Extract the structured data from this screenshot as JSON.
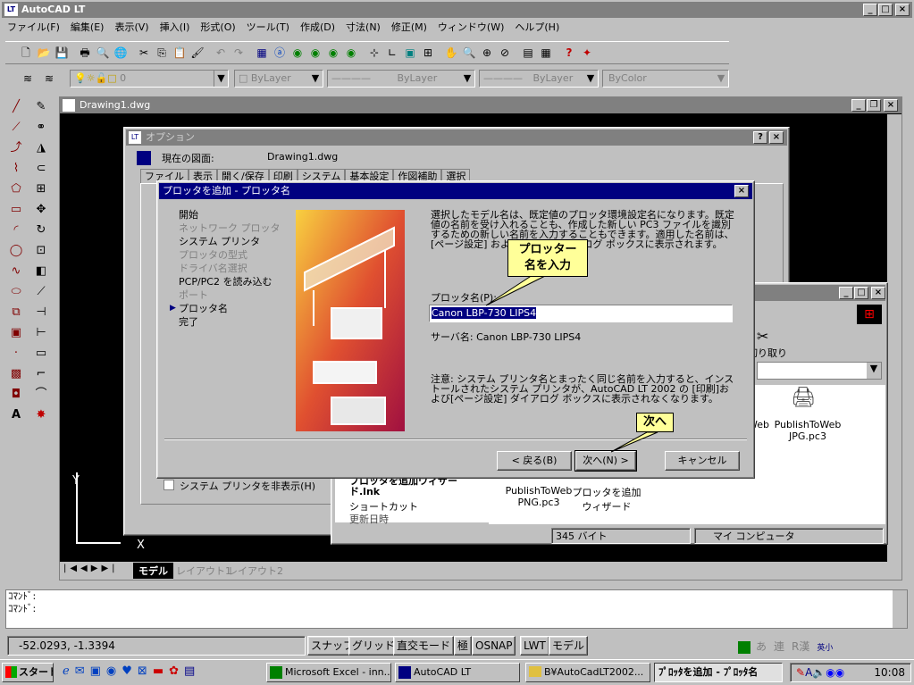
{
  "app": {
    "title": "AutoCAD LT"
  },
  "menu": [
    "ファイル(F)",
    "編集(E)",
    "表示(V)",
    "挿入(I)",
    "形式(O)",
    "ツール(T)",
    "作成(D)",
    "寸法(N)",
    "修正(M)",
    "ウィンドウ(W)",
    "ヘルプ(H)"
  ],
  "layer": {
    "name": "0",
    "color": "ByLayer",
    "linetype": "ByLayer",
    "lineweight": "ByLayer",
    "plotstyle": "ByColor"
  },
  "drawing": {
    "title": "Drawing1.dwg",
    "tabs": [
      "モデル",
      "レイアウト1",
      "レイアウト2"
    ],
    "ucs_y": "Y",
    "ucs_x": "X"
  },
  "options": {
    "title": "オプション",
    "current_label": "現在の図面:",
    "current_value": "Drawing1.dwg",
    "tabs": [
      "ファイル",
      "表示",
      "開く/保存",
      "印刷",
      "システム",
      "基本設定",
      "作図補助",
      "選択"
    ],
    "checkbox_label": "システム プリンタを非表示(H)"
  },
  "wizard": {
    "title": "プロッタを追加 - プロッタ名",
    "steps": [
      "開始",
      "ネットワーク プロッタ",
      "システム プリンタ",
      "プロッタの型式",
      "ドライバ名選択",
      "PCP/PC2 を読み込む",
      "ポート",
      "プロッタ名",
      "完了"
    ],
    "current_marker": "▶",
    "description": "選択したモデル名は、既定値のプロッタ環境設定名になります。既定値の名前を受け入れることも、作成した新しい PC3 ファイルを識別するための新しい名前を入力することもできます。適用した名前は、[ページ設定] および [印刷] ダイアログ ボックスに表示されます。",
    "plotter_name_label": "プロッタ名(P):",
    "plotter_name_value": "Canon LBP-730 LIPS4",
    "server_label": "サーバ名: Canon LBP-730 LIPS4",
    "note": "注意: システム プリンタ名とまったく同じ名前を入力すると、インストールされたシステム プリンタが、AutoCAD LT 2002 の [印刷]および[ページ設定] ダイアログ ボックスに表示されなくなります。",
    "back_button": "< 戻る(B)",
    "next_button": "次へ(N) >",
    "cancel_button": "キャンセル"
  },
  "callouts": {
    "name": "プロッター\n名を入力",
    "next": "次へ"
  },
  "explorer": {
    "cut_label": "切り取り",
    "files": [
      {
        "name": "PublishToWeb JPG.pc3"
      },
      {
        "name": "PublishToWeb PNG.pc3"
      },
      {
        "name": "プロッタを追加 ウィザード"
      }
    ],
    "side_title": "プロッタを追加ウィザード.lnk",
    "side_sub": "ショートカット",
    "side_more": "更新日時",
    "partial_web": "Web",
    "status_size": "345 バイト",
    "status_location": "マイ コンピュータ"
  },
  "command": {
    "line1": "ｺﾏﾝﾄﾞ:",
    "line2": "ｺﾏﾝﾄﾞ:"
  },
  "status": {
    "coords": "-52.0293, -1.3394",
    "snap": "スナップ",
    "grid": "グリッド",
    "ortho": "直交モード",
    "polar": "極",
    "osnap": "OSNAP",
    "lwt": "LWT",
    "model": "モデル"
  },
  "ime": [
    "あ",
    "連",
    "R漢",
    "英小"
  ],
  "taskbar": {
    "start": "スタート",
    "buttons": [
      "Microsoft Excel - inn...",
      "AutoCAD LT",
      "B¥AutoCadLT2002...",
      "ﾌﾟﾛｯﾀを追加 - ﾌﾟﾛｯﾀ名"
    ],
    "clock": "10:08"
  }
}
